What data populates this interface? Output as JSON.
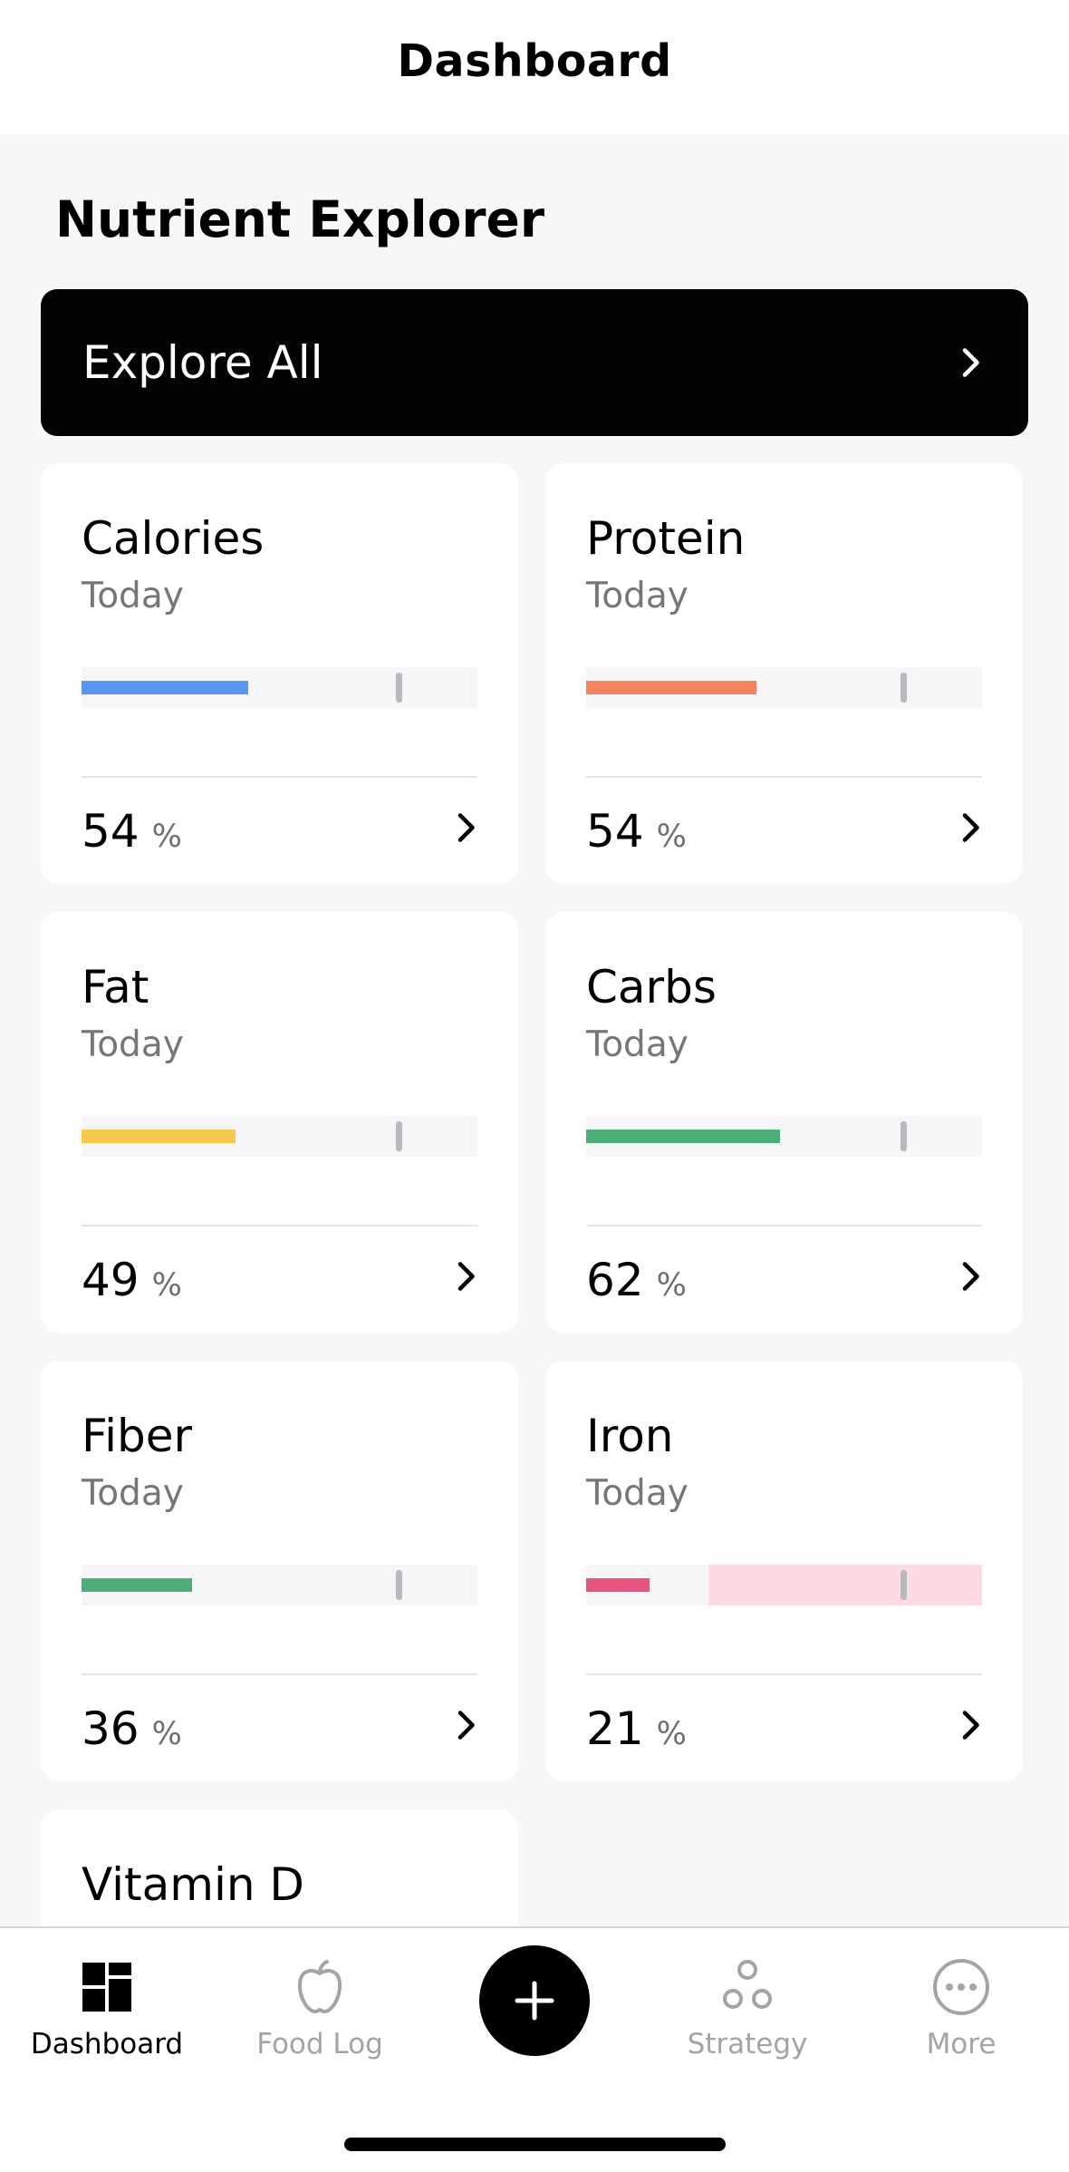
{
  "header": {
    "title": "Dashboard"
  },
  "section": {
    "title": "Nutrient Explorer"
  },
  "explore": {
    "label": "Explore All",
    "icon": "chevron-right-icon"
  },
  "cards": [
    {
      "name": "Calories",
      "sub": "Today",
      "value": "54",
      "unit": "%",
      "color": "#5b95f2",
      "fill_fraction": 0.42,
      "target_fraction": 0.8
    },
    {
      "name": "Protein",
      "sub": "Today",
      "value": "54",
      "unit": "%",
      "color": "#f5845e",
      "fill_fraction": 0.43,
      "target_fraction": 0.8
    },
    {
      "name": "Fat",
      "sub": "Today",
      "value": "49",
      "unit": "%",
      "color": "#f6c94a",
      "fill_fraction": 0.39,
      "target_fraction": 0.8
    },
    {
      "name": "Carbs",
      "sub": "Today",
      "value": "62",
      "unit": "%",
      "color": "#4caf78",
      "fill_fraction": 0.49,
      "target_fraction": 0.8
    },
    {
      "name": "Fiber",
      "sub": "Today",
      "value": "36",
      "unit": "%",
      "color": "#4caf78",
      "fill_fraction": 0.28,
      "target_fraction": 0.8
    },
    {
      "name": "Iron",
      "sub": "Today",
      "value": "21",
      "unit": "%",
      "color": "#e6557d",
      "fill_fraction": 0.16,
      "target_fraction": 0.8,
      "zone_start_fraction": 0.31,
      "zone_color": "#fcdce2"
    }
  ],
  "partial_card": {
    "name": "Vitamin D"
  },
  "tabbar": {
    "tabs": [
      {
        "label": "Dashboard",
        "icon": "dashboard-icon",
        "active": true
      },
      {
        "label": "Food Log",
        "icon": "apple-icon",
        "active": false
      },
      {
        "label": "Strategy",
        "icon": "strategy-icon",
        "active": false
      },
      {
        "label": "More",
        "icon": "more-icon",
        "active": false
      }
    ],
    "add_icon": "plus-icon"
  },
  "colors": {
    "accent": "#000000",
    "background": "#f7f7f9",
    "inactive_tab": "#a3a3a8"
  }
}
